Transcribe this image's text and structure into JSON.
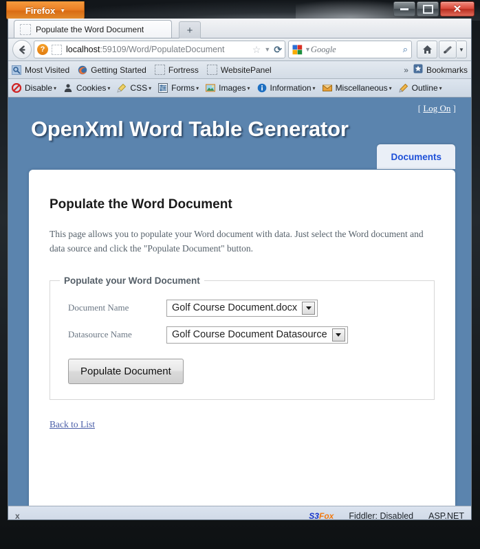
{
  "window": {
    "app_button_label": "Firefox",
    "app_button_caret": "▼",
    "controls": {
      "minimize": "minimize-button",
      "restore": "restore-button",
      "close": "✕"
    }
  },
  "browser": {
    "tab": {
      "title": "Populate the Word Document",
      "new_tab_label": "+"
    },
    "navbar": {
      "back_label": "Back",
      "identity_icon_label": "?",
      "url_host": "localhost",
      "url_rest": ":59109/Word/PopulateDocument",
      "star": "☆",
      "dropmarker": "▼",
      "reload": "⟳",
      "search_engine": "Google",
      "search_icon": "⌕",
      "home_icon": "⌂",
      "tool_caret": "▼"
    },
    "bookmarks": [
      {
        "label": "Most Visited",
        "icon": "most-visited-icon"
      },
      {
        "label": "Getting Started",
        "icon": "firefox-icon"
      },
      {
        "label": "Fortress",
        "icon": "dashed-favicon"
      },
      {
        "label": "WebsitePanel",
        "icon": "dashed-favicon"
      }
    ],
    "bookmarks_overflow": "»",
    "bookmarks_menu_label": "Bookmarks",
    "devtoolbar": [
      {
        "label": "Disable",
        "icon": "disable-icon",
        "caret": "▾"
      },
      {
        "label": "Cookies",
        "icon": "cookies-icon",
        "caret": "▾"
      },
      {
        "label": "CSS",
        "icon": "css-icon",
        "caret": "▾"
      },
      {
        "label": "Forms",
        "icon": "forms-icon",
        "caret": "▾"
      },
      {
        "label": "Images",
        "icon": "images-icon",
        "caret": "▾"
      },
      {
        "label": "Information",
        "icon": "information-icon",
        "caret": "▾"
      },
      {
        "label": "Miscellaneous",
        "icon": "miscellaneous-icon",
        "caret": "▾"
      },
      {
        "label": "Outline",
        "icon": "outline-icon",
        "caret": "▾"
      }
    ]
  },
  "site": {
    "title": "OpenXml Word Table Generator",
    "logon_open": "[",
    "logon_label": "Log On",
    "logon_close": "]",
    "tabs": [
      {
        "label": "Documents",
        "selected": true
      }
    ],
    "heading": "Populate the Word Document",
    "intro": "This page allows you to populate your Word document with data. Just select the Word document and data source and click the \"Populate Document\" button.",
    "fieldset": {
      "legend": "Populate your Word Document",
      "rows": [
        {
          "label": "Document Name",
          "value": "Golf Course Document.docx",
          "name": "document-name-select"
        },
        {
          "label": "Datasource Name",
          "value": "Golf Course Document Datasource",
          "name": "datasource-name-select"
        }
      ],
      "submit_label": "Populate Document"
    },
    "back_link": "Back to List",
    "colors": {
      "page_background": "#5b84ae",
      "content_background": "#ffffff",
      "tab_text": "#1d4fd8",
      "link": "#4a5ea8"
    }
  },
  "statusbar": {
    "close_label": "x",
    "s3fox_prefix": "S3",
    "s3fox_suffix": "Fox",
    "fiddler": "Fiddler: Disabled",
    "aspnet": "ASP.NET"
  }
}
